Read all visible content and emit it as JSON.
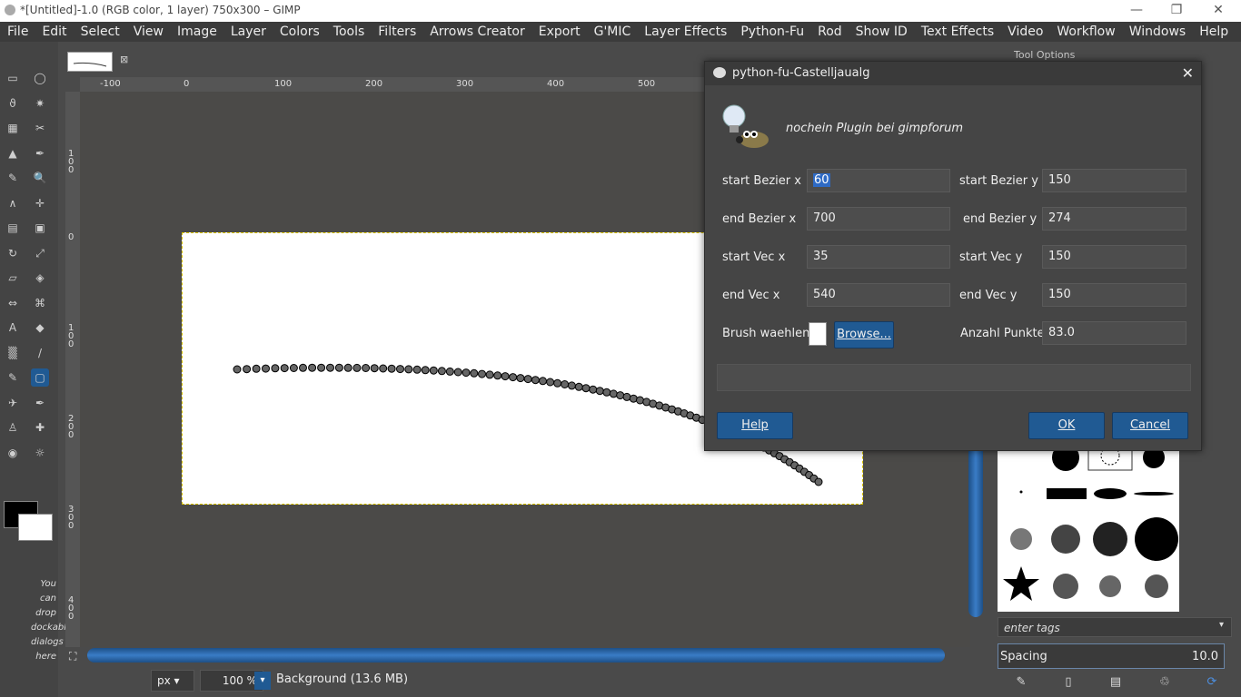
{
  "window": {
    "title": "*[Untitled]-1.0 (RGB color, 1 layer) 750x300 – GIMP",
    "minimize": "—",
    "maximize": "❐",
    "close": "✕"
  },
  "menubar": {
    "items": [
      "File",
      "Edit",
      "Select",
      "View",
      "Image",
      "Layer",
      "Colors",
      "Tools",
      "Filters",
      "Arrows Creator",
      "Export",
      "G'MIC",
      "Layer Effects",
      "Python-Fu",
      "Rod",
      "Show ID",
      "Text Effects",
      "Video",
      "Workflow",
      "Windows",
      "Help"
    ]
  },
  "toolbox": {
    "hint_lines": [
      "You",
      "can",
      "drop",
      "dockable",
      "dialogs",
      "here"
    ]
  },
  "ruler": {
    "h_ticks": [
      "-100",
      "0",
      "100",
      "200",
      "300",
      "400",
      "500"
    ],
    "v_ticks": [
      "1\n0\n0",
      "0",
      "1\n0\n0",
      "2\n0\n0",
      "3\n0\n0",
      "4\n0\n0"
    ]
  },
  "statusbar": {
    "unit": "px",
    "zoom": "100 %",
    "layer_info": "Background (13.6 MB)"
  },
  "dock": {
    "tool_options_title": "Tool Options",
    "tags_placeholder": "enter tags",
    "spacing_label": "Spacing",
    "spacing_value": "10.0"
  },
  "dialog": {
    "title": "python-fu-Castelljaualg",
    "close": "✕",
    "description": "nochein Plugin bei gimpforum",
    "fields": {
      "start_bezier_x": {
        "label": "start Bezier x",
        "value": "60"
      },
      "start_bezier_y": {
        "label": "start Bezier y",
        "value": "150"
      },
      "end_bezier_x": {
        "label": "end Bezier x",
        "value": "700"
      },
      "end_bezier_y": {
        "label": "end Bezier y",
        "value": "274"
      },
      "start_vec_x": {
        "label": "start Vec x",
        "value": "35"
      },
      "start_vec_y": {
        "label": "start Vec y",
        "value": "150"
      },
      "end_vec_x": {
        "label": "end Vec x",
        "value": "540"
      },
      "end_vec_y": {
        "label": "end Vec y",
        "value": "150"
      },
      "brush": {
        "label": "Brush waehlen",
        "browse": "Browse..."
      },
      "anzahl_punkte": {
        "label": "Anzahl Punkte",
        "value": "83.0"
      }
    },
    "buttons": {
      "help": "Help",
      "ok": "OK",
      "cancel": "Cancel"
    }
  },
  "colors": {
    "accent": "#2e6ac4",
    "button_blue": "#205a93",
    "selection_dash": "#d8c200"
  }
}
